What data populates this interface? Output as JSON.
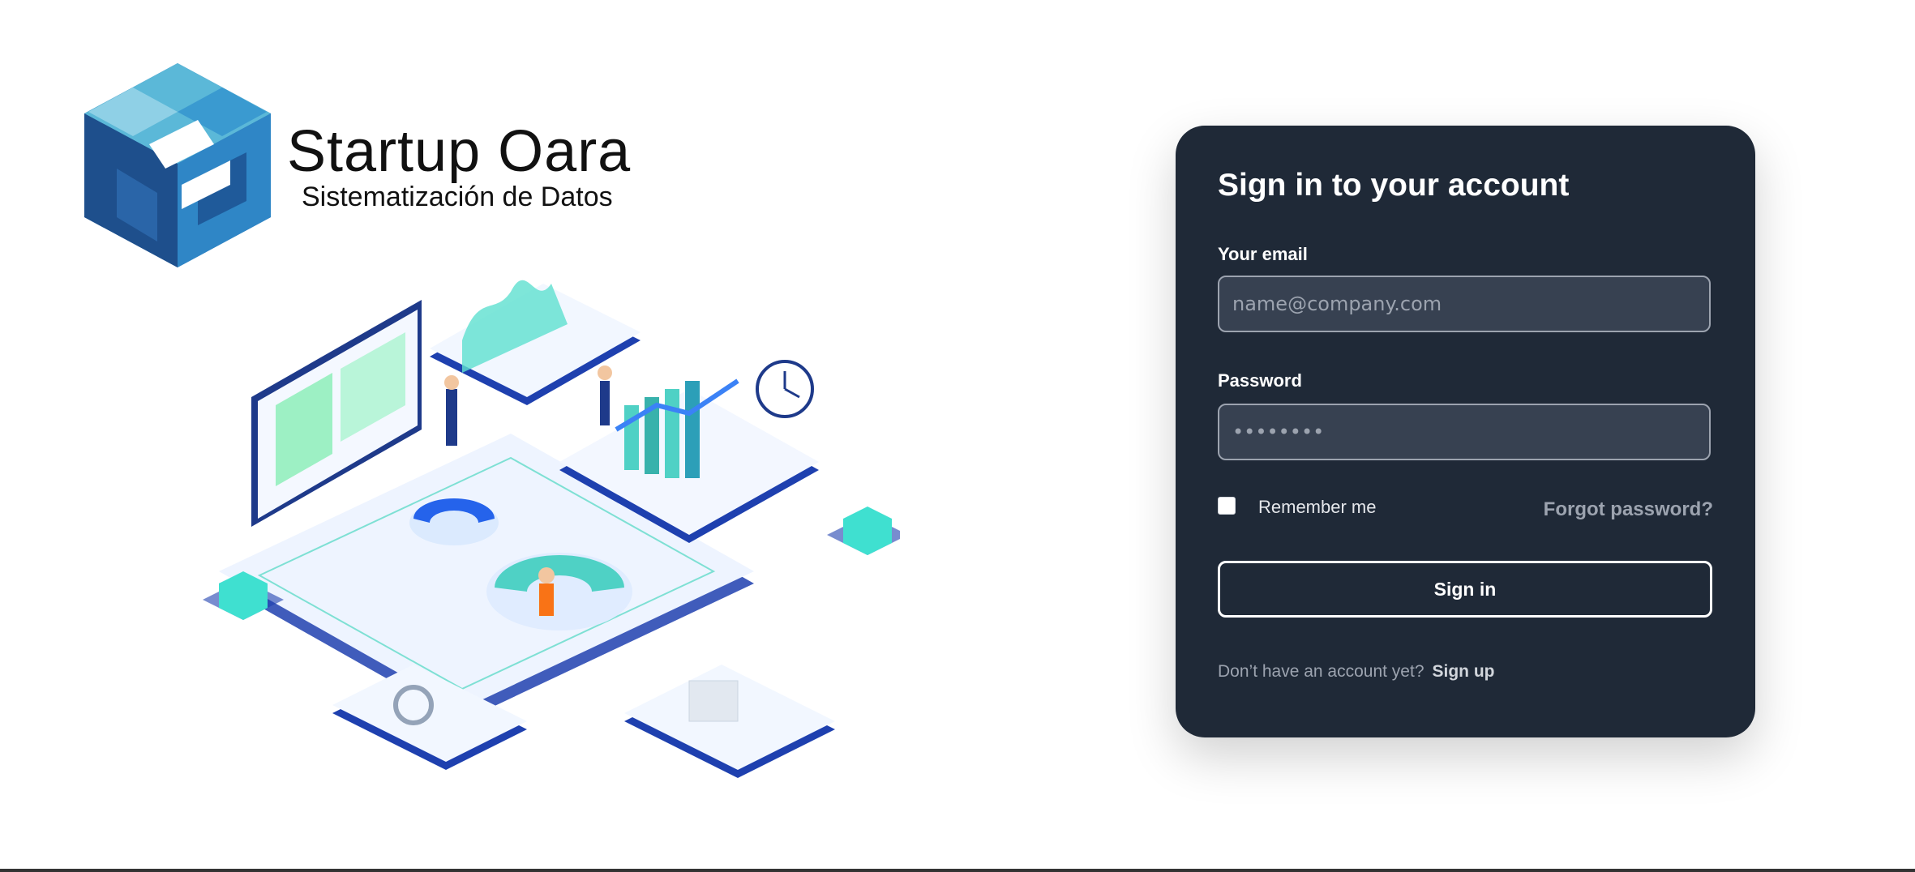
{
  "brand": {
    "name": "Startup Oara",
    "tagline": "Sistematización de Datos"
  },
  "login": {
    "title": "Sign in to your account",
    "email_label": "Your email",
    "email_placeholder": "name@company.com",
    "password_label": "Password",
    "password_placeholder": "••••••••",
    "remember_label": "Remember me",
    "remember_checked": false,
    "forgot_label": "Forgot password?",
    "signin_label": "Sign in",
    "signup_prompt": "Don’t have an account yet?",
    "signup_label": "Sign up"
  },
  "colors": {
    "card_bg": "#1f2937",
    "input_bg": "#374151",
    "muted_text": "#9ca3af",
    "accent_blue": "#1e3a8a",
    "accent_teal": "#2dd4bf"
  },
  "icons": {
    "logo": "hexagon-cube-logo",
    "illustration": "isometric-data-analytics-illustration"
  }
}
